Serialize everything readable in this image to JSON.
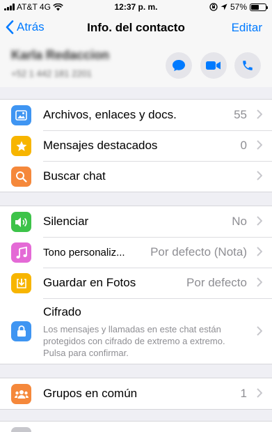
{
  "status_bar": {
    "carrier": "AT&T 4G",
    "time": "12:37 p. m.",
    "battery": "57%",
    "battery_level": 0.57,
    "icons": [
      "signal-icon",
      "wifi-icon",
      "orientation-lock-icon",
      "location-icon",
      "battery-icon"
    ]
  },
  "nav": {
    "back_label": "Atrás",
    "title": "Info. del contacto",
    "edit_label": "Editar"
  },
  "contact": {
    "name": "Karla Redaccion",
    "phone": "+52 1 442 181 2201",
    "actions": [
      "message-icon",
      "video-call-icon",
      "phone-icon"
    ]
  },
  "groups": [
    [
      {
        "icon": "photo-icon",
        "color": "#3f95f2",
        "label": "Archivos, enlaces y docs.",
        "value": "55"
      },
      {
        "icon": "star-icon",
        "color": "#f7b500",
        "label": "Mensajes destacados",
        "value": "0"
      },
      {
        "icon": "search-icon",
        "color": "#f5883b",
        "label": "Buscar chat",
        "value": ""
      }
    ],
    [
      {
        "icon": "speaker-icon",
        "color": "#3dc349",
        "label": "Silenciar",
        "value": "No"
      },
      {
        "icon": "music-note-icon",
        "color": "#e46ad6",
        "label": "Tono personaliz...",
        "value": "Por defecto (Nota)"
      },
      {
        "icon": "download-icon",
        "color": "#f7b500",
        "label": "Guardar en Fotos",
        "value": "Por defecto"
      },
      {
        "icon": "lock-icon",
        "color": "#3f95f2",
        "label": "Cifrado",
        "description": "Los mensajes y llamadas en este chat están protegidos con cifrado de extremo a extremo. Pulsa para confirmar."
      }
    ],
    [
      {
        "icon": "group-icon",
        "color": "#f5883b",
        "label": "Grupos en común",
        "value": "1"
      }
    ]
  ],
  "colors": {
    "accent": "#007aff",
    "background": "#efeff4"
  }
}
